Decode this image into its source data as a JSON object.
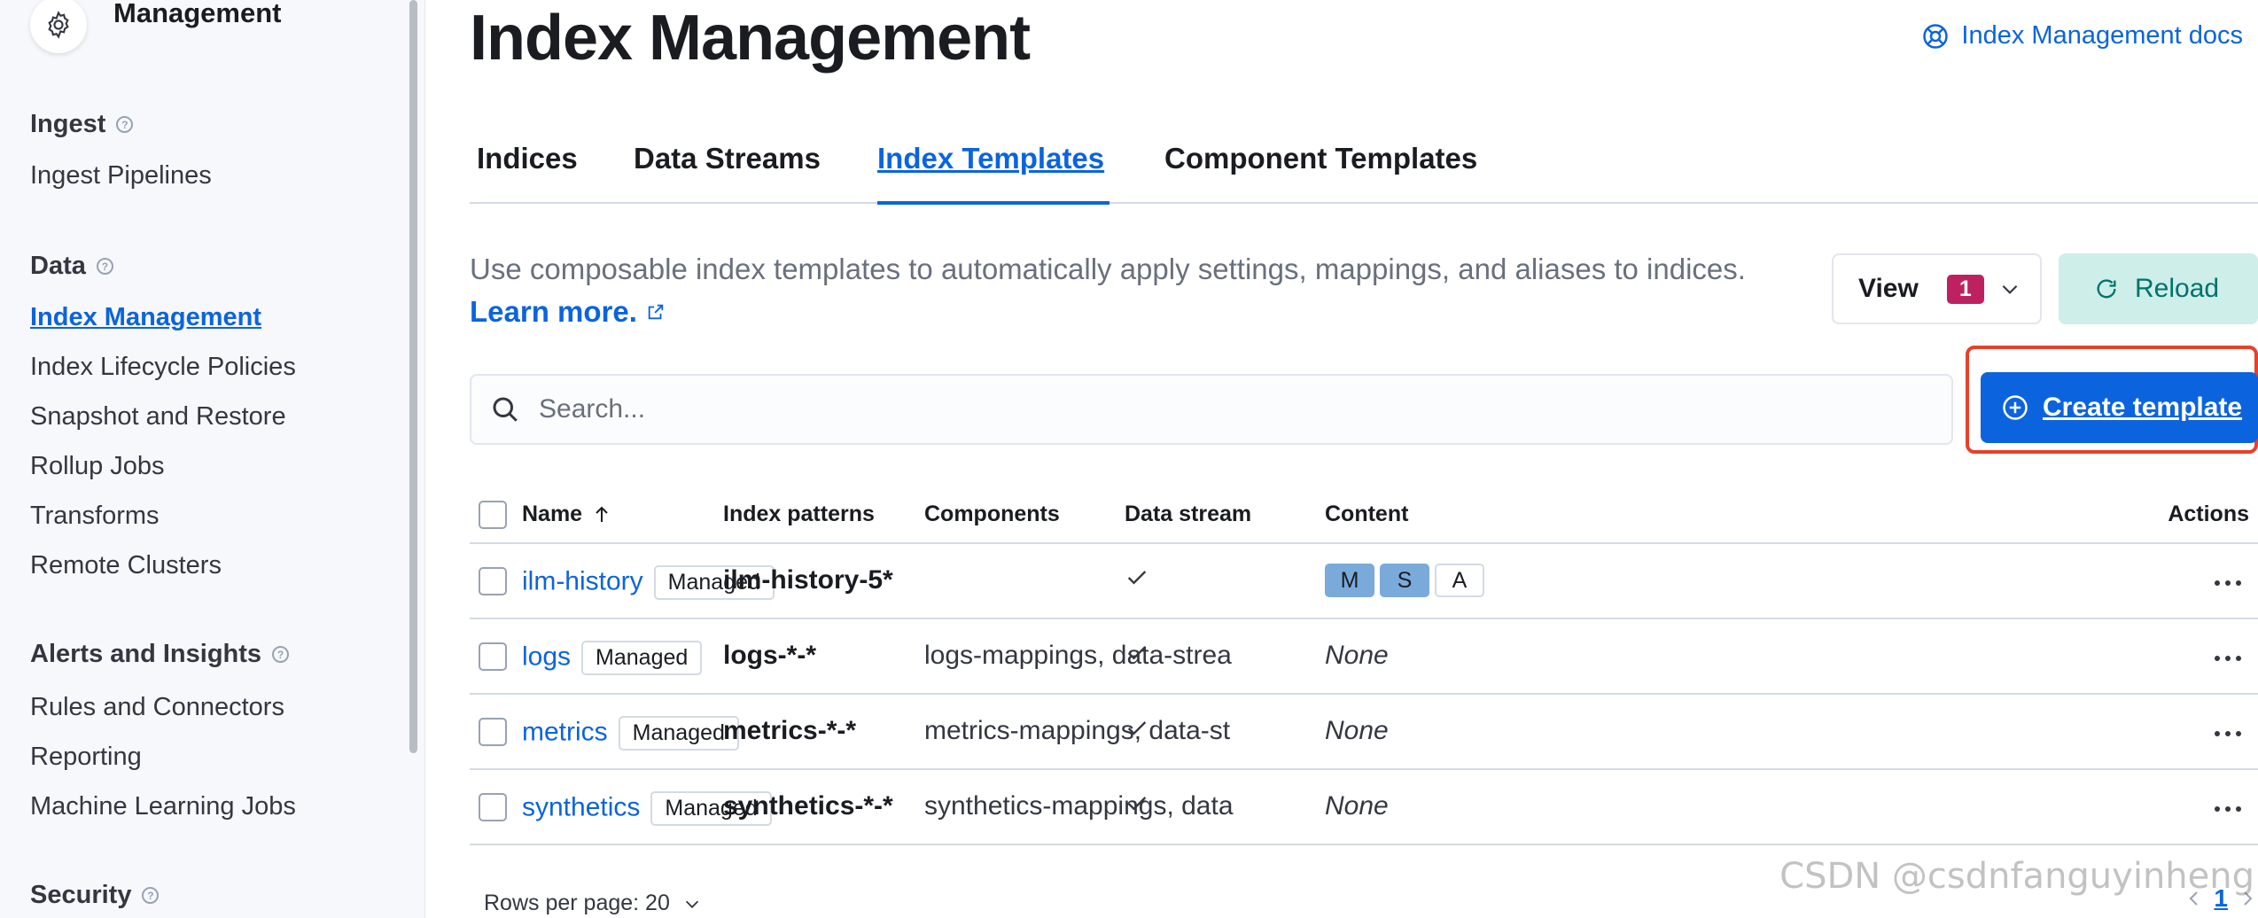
{
  "sidebar": {
    "app_title": "Management",
    "sections": [
      {
        "label": "Ingest",
        "items": [
          "Ingest Pipelines"
        ]
      },
      {
        "label": "Data",
        "items": [
          "Index Management",
          "Index Lifecycle Policies",
          "Snapshot and Restore",
          "Rollup Jobs",
          "Transforms",
          "Remote Clusters"
        ]
      },
      {
        "label": "Alerts and Insights",
        "items": [
          "Rules and Connectors",
          "Reporting",
          "Machine Learning Jobs"
        ]
      },
      {
        "label": "Security",
        "items": []
      }
    ],
    "active_item": "Index Management"
  },
  "header": {
    "title": "Index Management",
    "docs_link": "Index Management docs"
  },
  "tabs": [
    {
      "label": "Indices",
      "active": false
    },
    {
      "label": "Data Streams",
      "active": false
    },
    {
      "label": "Index Templates",
      "active": true
    },
    {
      "label": "Component Templates",
      "active": false
    }
  ],
  "description": {
    "text": "Use composable index templates to automatically apply settings, mappings, and aliases to indices.",
    "learn_more": "Learn more."
  },
  "toolbar": {
    "view_label": "View",
    "view_count": "1",
    "reload_label": "Reload",
    "create_label": "Create template",
    "search_placeholder": "Search..."
  },
  "table": {
    "columns": [
      "Name",
      "Index patterns",
      "Components",
      "Data stream",
      "Content",
      "Actions"
    ],
    "rows": [
      {
        "name": "ilm-history",
        "badge": "Managed",
        "pattern": "ilm-history-5*",
        "components": "",
        "data_stream": true,
        "content": [
          "M",
          "S",
          "A"
        ],
        "none_label": ""
      },
      {
        "name": "logs",
        "badge": "Managed",
        "pattern": "logs-*-*",
        "components": "logs-mappings, data-strea",
        "data_stream": true,
        "content": [],
        "none_label": "None"
      },
      {
        "name": "metrics",
        "badge": "Managed",
        "pattern": "metrics-*-*",
        "components": "metrics-mappings, data-st",
        "data_stream": true,
        "content": [],
        "none_label": "None"
      },
      {
        "name": "synthetics",
        "badge": "Managed",
        "pattern": "synthetics-*-*",
        "components": "synthetics-mappings, data",
        "data_stream": true,
        "content": [],
        "none_label": "None"
      }
    ]
  },
  "footer": {
    "rows_per_page": "Rows per page: 20",
    "current_page": "1"
  },
  "watermark": "CSDN @csdnfanguyinheng",
  "colors": {
    "accent": "#0b64dd",
    "view_badge": "#bd2160",
    "reload_bg": "#cdeee9",
    "highlight": "#e8402a"
  }
}
